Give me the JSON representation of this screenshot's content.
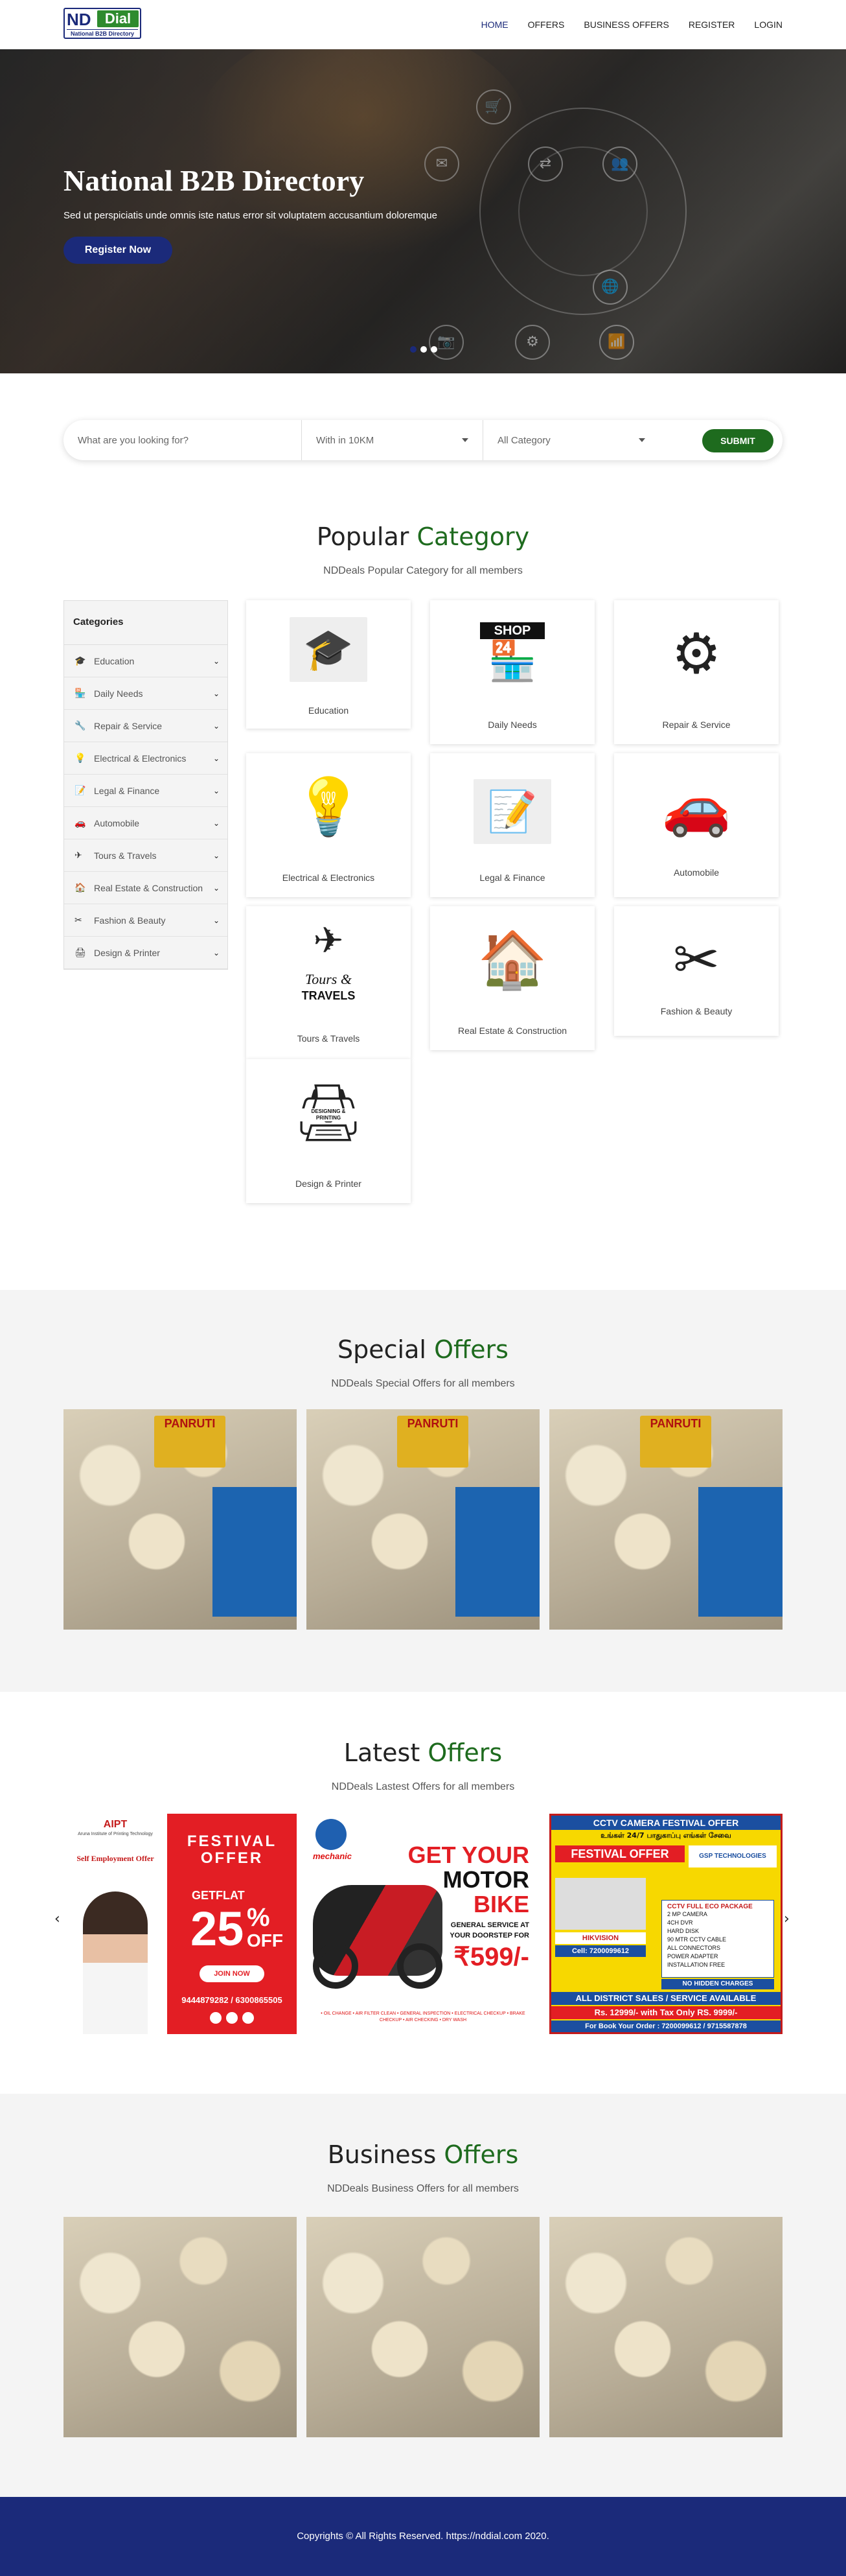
{
  "nav": {
    "logo": {
      "nd": "ND",
      "dial": "Dial",
      "tagline": "National B2B Directory"
    },
    "items": [
      "HOME",
      "OFFERS",
      "BUSINESS OFFERS",
      "REGISTER",
      "LOGIN"
    ]
  },
  "hero": {
    "title": "National B2B Directory",
    "subtitle": "Sed ut perspiciatis unde omnis iste natus error sit voluptatem accusantium doloremque",
    "button": "Register Now",
    "icons": [
      "cart-icon",
      "mail-icon",
      "share-icon",
      "users-icon",
      "gear-icon",
      "wifi-icon",
      "camera-icon",
      "globe-icon"
    ]
  },
  "search": {
    "placeholder": "What are you looking for?",
    "distance": "With in 10KM",
    "category": "All Category",
    "submit": "SUBMIT"
  },
  "category_section": {
    "title_a": "Popular",
    "title_b": "Category",
    "subtitle": "NDDeals Popular Category for all members",
    "sidebar_head": "Categories",
    "sidebar": [
      {
        "label": "Education",
        "icon": "graduate-icon",
        "glyph": "🎓"
      },
      {
        "label": "Daily Needs",
        "icon": "shop-icon",
        "glyph": "🏪"
      },
      {
        "label": "Repair & Service",
        "icon": "wrench-icon",
        "glyph": "🔧"
      },
      {
        "label": "Electrical & Electronics",
        "icon": "bulb-icon",
        "glyph": "💡"
      },
      {
        "label": "Legal & Finance",
        "icon": "document-icon",
        "glyph": "📝"
      },
      {
        "label": "Automobile",
        "icon": "car-icon",
        "glyph": "🚗"
      },
      {
        "label": "Tours & Travels",
        "icon": "plane-icon",
        "glyph": "✈"
      },
      {
        "label": "Real Estate & Construction",
        "icon": "house-icon",
        "glyph": "🏠"
      },
      {
        "label": "Fashion & Beauty",
        "icon": "comb-icon",
        "glyph": "✂"
      },
      {
        "label": "Design & Printer",
        "icon": "printer-icon",
        "glyph": "🖨"
      }
    ],
    "cards": [
      {
        "label": "Education",
        "icon": "graduate-icon",
        "glyph": "🎓"
      },
      {
        "label": "Daily Needs",
        "icon": "shop-icon",
        "glyph": "🏪"
      },
      {
        "label": "Repair & Service",
        "icon": "house-gear-icon",
        "glyph": "⚙"
      },
      {
        "label": "Electrical & Electronics",
        "icon": "bulb-icon",
        "glyph": "💡"
      },
      {
        "label": "Legal & Finance",
        "icon": "contract-icon",
        "glyph": "📝"
      },
      {
        "label": "Automobile",
        "icon": "mechanic-car-icon",
        "glyph": "🚗"
      },
      {
        "label": "Tours & Travels",
        "icon": "plane-globe-icon",
        "glyph": "✈"
      },
      {
        "label": "Real Estate & Construction",
        "icon": "house-icon",
        "glyph": "🏠"
      },
      {
        "label": "Fashion & Beauty",
        "icon": "beauty-tools-icon",
        "glyph": "✂"
      },
      {
        "label": "Design & Printer",
        "icon": "printer-icon",
        "glyph": "🖨"
      }
    ],
    "card_art_text": {
      "shop": "SHOP",
      "tours_a": "Tours &",
      "tours_b": "TRAVELS",
      "printer": "DESIGNING & PRINTING"
    }
  },
  "special_offers": {
    "title_a": "Special",
    "title_b": "Offers",
    "subtitle": "NDDeals Special Offers for all members",
    "brand": "PANRUTI"
  },
  "latest_offers": {
    "title_a": "Latest",
    "title_b": "Offers",
    "subtitle": "NDDeals Lastest Offers for all members",
    "banner1": {
      "brand": "AIPT",
      "brand_sub": "Aruna Institute of Printing Technology",
      "tagline": "Self Employment Offer",
      "festival": "FESTIVAL",
      "offer": "OFFER",
      "getflat": "GETFLAT",
      "pct": "25",
      "pct_sign": "%",
      "off": "OFF",
      "join": "JOIN NOW",
      "phones": "9444879282 / 6300865505"
    },
    "banner2": {
      "brand": "mechanic",
      "l1": "GET YOUR",
      "l2": "MOTOR",
      "l3": "BIKE",
      "l4": "GENERAL SERVICE AT",
      "l5": "YOUR DOORSTEP FOR",
      "price": "₹599/-",
      "services": "• OIL CHANGE • AIR FILTER CLEAN • GENERAL INSPECTION • ELECTRICAL CHECKUP • BRAKE CHECKUP • AIR CHECKING • DRY WASH"
    },
    "banner3": {
      "head": "CCTV CAMERA FESTIVAL OFFER",
      "sub": "உங்கள் 24/7 பாதுகாப்பு எங்கள் சேவை",
      "festival": "FESTIVAL OFFER",
      "company": "GSP TECHNOLOGIES",
      "cell": "Cell: 7200099612",
      "brand": "HIKVISION",
      "pkg_title": "CCTV FULL ECO PACKAGE",
      "pkg": [
        "2 MP CAMERA",
        "4CH DVR",
        "HARD DISK",
        "90 MTR CCTV CABLE",
        "ALL CONNECTORS",
        "POWER ADAPTER",
        "INSTALLATION FREE"
      ],
      "no_hidden": "NO HIDDEN CHARGES",
      "district": "ALL DISTRICT SALES / SERVICE AVAILABLE",
      "price": "Rs. 12999/- with Tax Only RS. 9999/-",
      "book": "For Book Your Order : 7200099612 / 9715587878"
    },
    "prev": "‹",
    "next": "›"
  },
  "business_offers": {
    "title_a": "Business",
    "title_b": "Offers",
    "subtitle": "NDDeals Business Offers for all members"
  },
  "footer": {
    "text": "Copyrights © All Rights Reserved. https://nddial.com 2020."
  },
  "colors": {
    "primary": "#1b2a7a",
    "accent": "#1e6b1e",
    "promo_red": "#e31e24"
  }
}
